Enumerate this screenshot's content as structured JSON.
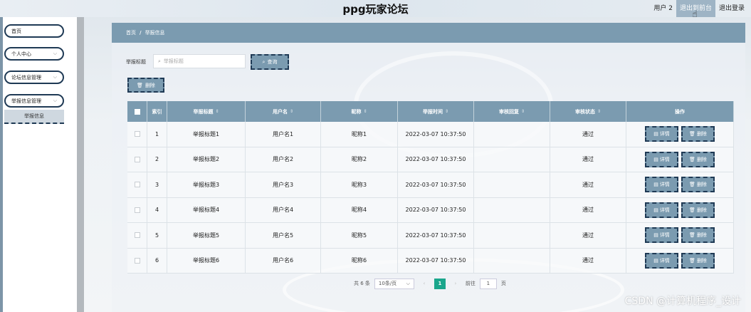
{
  "header": {
    "title": "ppg玩家论坛",
    "user": "用户 2",
    "front_label": "退出到前台",
    "logout_label": "退出登录"
  },
  "sidebar": {
    "items": [
      {
        "label": "首页",
        "has_arrow": false
      },
      {
        "label": "个人中心",
        "has_arrow": true
      },
      {
        "label": "论坛信息管理",
        "has_arrow": true
      },
      {
        "label": "举报信息管理",
        "has_arrow": true
      }
    ],
    "sub_item": "举报信息"
  },
  "breadcrumb": {
    "home": "首页",
    "separator": "/",
    "current": "举报信息"
  },
  "search": {
    "label": "举报标题",
    "placeholder": "举报标题",
    "button": "查询"
  },
  "toolbar": {
    "delete_label": "删除"
  },
  "table": {
    "headers": [
      "索引",
      "举报标题",
      "用户名",
      "昵称",
      "举报时间",
      "审核回复",
      "审核状态",
      "操作"
    ],
    "rows": [
      {
        "index": "1",
        "title": "举报标题1",
        "username": "用户名1",
        "nickname": "昵称1",
        "time": "2022-03-07 10:37:50",
        "reply": "",
        "status": "通过"
      },
      {
        "index": "2",
        "title": "举报标题2",
        "username": "用户名2",
        "nickname": "昵称2",
        "time": "2022-03-07 10:37:50",
        "reply": "",
        "status": "通过"
      },
      {
        "index": "3",
        "title": "举报标题3",
        "username": "用户名3",
        "nickname": "昵称3",
        "time": "2022-03-07 10:37:50",
        "reply": "",
        "status": "通过"
      },
      {
        "index": "4",
        "title": "举报标题4",
        "username": "用户名4",
        "nickname": "昵称4",
        "time": "2022-03-07 10:37:50",
        "reply": "",
        "status": "通过"
      },
      {
        "index": "5",
        "title": "举报标题5",
        "username": "用户名5",
        "nickname": "昵称5",
        "time": "2022-03-07 10:37:50",
        "reply": "",
        "status": "通过"
      },
      {
        "index": "6",
        "title": "举报标题6",
        "username": "用户名6",
        "nickname": "昵称6",
        "time": "2022-03-07 10:37:50",
        "reply": "",
        "status": "通过"
      }
    ],
    "detail_label": "详情",
    "delete_label": "删除"
  },
  "pagination": {
    "total": "共 6 条",
    "page_size": "10条/页",
    "current_page": "1",
    "goto_label": "前往",
    "goto_value": "1",
    "page_unit": "页"
  },
  "watermark": "CSDN @计算机程序_设计",
  "colors": {
    "accent": "#7b9bb0",
    "border_dark": "#1f3a55",
    "page_active": "#1aa68c"
  }
}
